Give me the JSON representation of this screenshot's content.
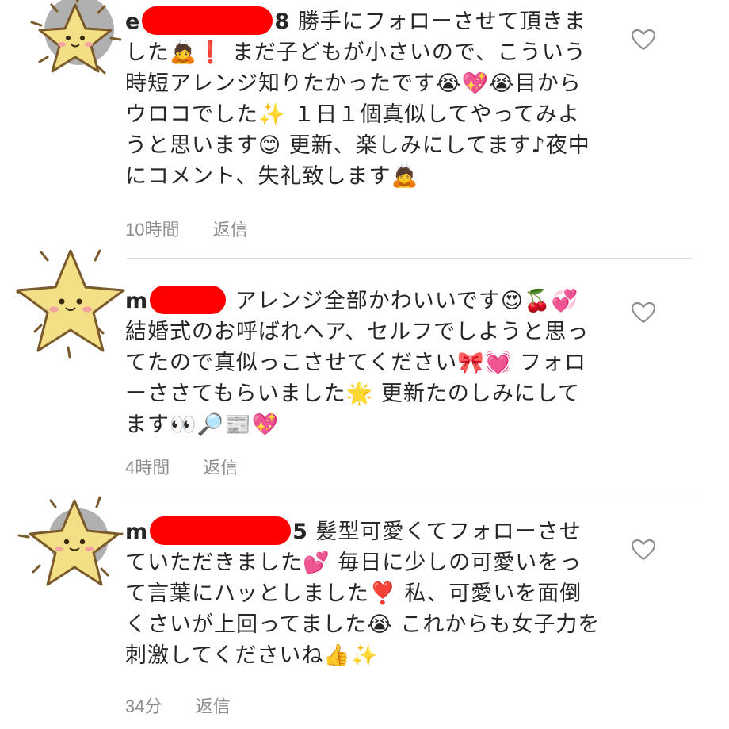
{
  "comments": [
    {
      "username_start": "e",
      "username_end": "8",
      "text": "勝手にフォローさせて頂きました🙇❗️ まだ子どもが小さいので、こういう時短アレンジ知りたかったです😭💖😭目からウロコでした✨ １日１個真似してやってみようと思います😊 更新、楽しみにしてます♪夜中にコメント、失礼致します🙇",
      "time": "10時間",
      "reply": "返信",
      "like_icon": "heart-outline-icon"
    },
    {
      "username_start": "m",
      "username_end": "",
      "text": "アレンジ全部かわいいです😍🍒💞 結婚式のお呼ばれヘア、セルフでしようと思ってたので真似っこさせてください🎀💓 フォローささてもらいました🌟 更新たのしみにしてます👀🔎📰💖",
      "time": "4時間",
      "reply": "返信",
      "like_icon": "heart-outline-icon"
    },
    {
      "username_start": "m",
      "username_end": "5",
      "text": "髪型可愛くてフォローさせていただきました💕 毎日に少しの可愛いをって言葉にハッとしました❣️ 私、可愛いを面倒くさいが上回ってました😭 これからも女子力を刺激してくださいね👍✨",
      "time": "34分",
      "reply": "返信",
      "like_icon": "heart-outline-icon"
    }
  ],
  "colors": {
    "redaction": "#ff0000",
    "meta_text": "#8e8e8e",
    "divider": "#dbdbdb",
    "star_fill": "#f3df86",
    "star_outline": "#7a5a2b"
  },
  "icons": {
    "avatar_sticker": "star-face-icon",
    "like": "heart-outline-icon"
  }
}
